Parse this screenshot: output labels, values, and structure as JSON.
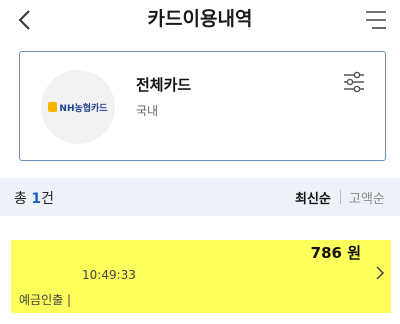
{
  "header": {
    "title": "카드이용내역",
    "back_icon": "chevron-left-icon",
    "menu_icon": "hamburger-menu-icon"
  },
  "card": {
    "logo_text": "NH농협카드",
    "name": "전체카드",
    "region": "국내",
    "filter_icon": "sliders-icon"
  },
  "summary": {
    "count_prefix": "총 ",
    "count": "1",
    "count_suffix": "건",
    "sort_latest": "최신순",
    "sort_amount": "고액순"
  },
  "transactions": [
    {
      "amount": "786 원",
      "time": "10:49:33",
      "type": "예금인출 |",
      "highlight_color": "#ffff5c"
    }
  ],
  "colors": {
    "accent": "#1f5fbf",
    "card_border": "#6b8fb8",
    "summary_bg": "#eef2f8"
  }
}
